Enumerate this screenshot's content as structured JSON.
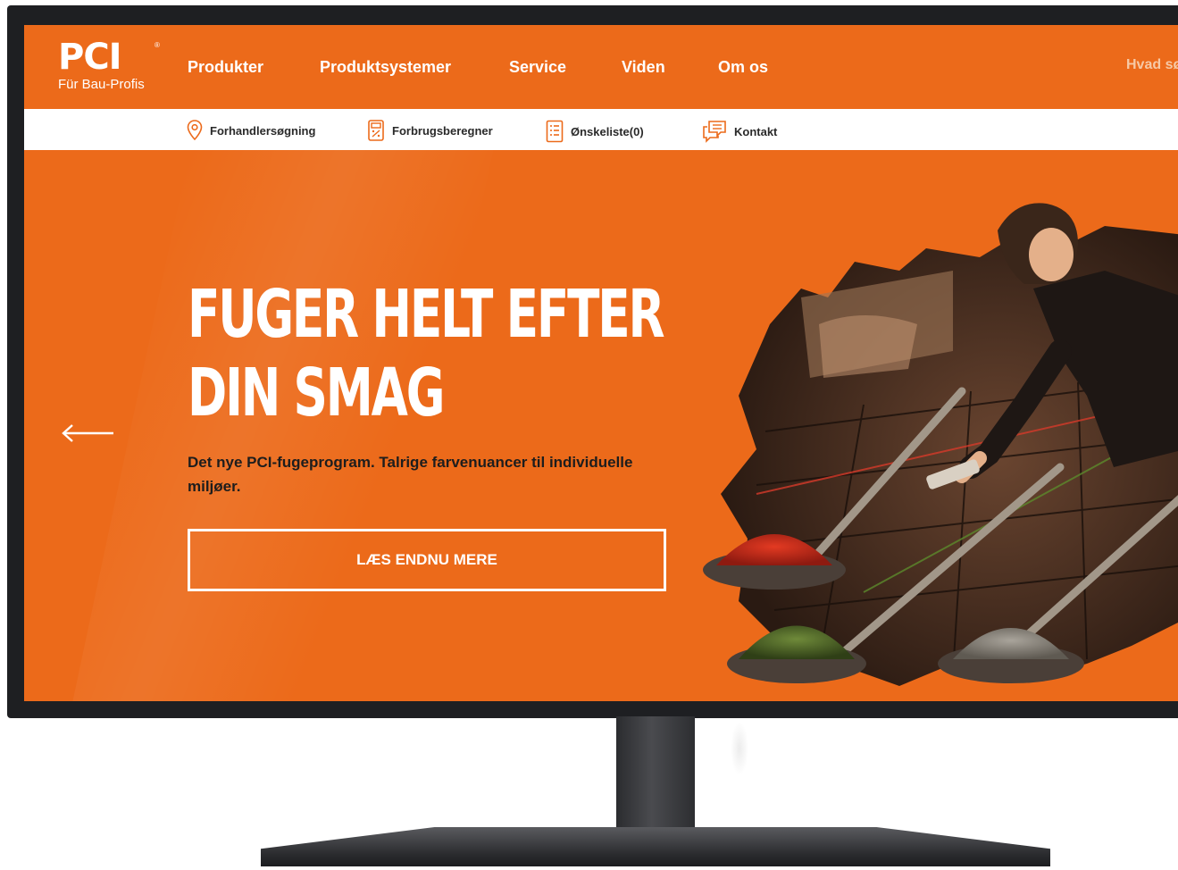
{
  "brand": {
    "logo": "PCI",
    "registered": "®",
    "tagline": "Für Bau-Profis"
  },
  "nav": {
    "items": [
      {
        "label": "Produkter"
      },
      {
        "label": "Produktsystemer"
      },
      {
        "label": "Service"
      },
      {
        "label": "Viden"
      },
      {
        "label": "Om os"
      }
    ],
    "search_partial": "Hvad sø"
  },
  "utility": {
    "items": [
      {
        "label": "Forhandlersøgning",
        "icon": "map-pin-icon"
      },
      {
        "label": "Forbrugsberegner",
        "icon": "calculator-icon"
      },
      {
        "label": "Ønskeliste(0)",
        "icon": "list-icon"
      },
      {
        "label": "Kontakt",
        "icon": "chat-icon"
      }
    ]
  },
  "hero": {
    "title_line1": "FUGER HELT EFTER",
    "title_line2": "DIN SMAG",
    "subtitle": "Det nye PCI-fugeprogram. Talrige farvenuancer til individuelle miljøer.",
    "cta": "LÆS ENDNU MERE",
    "prev_icon": "arrow-left-icon"
  },
  "colors": {
    "brand_orange": "#ec6a1a",
    "white": "#ffffff",
    "text_dark": "#1d1d1d",
    "bezel": "#1e1f22"
  }
}
